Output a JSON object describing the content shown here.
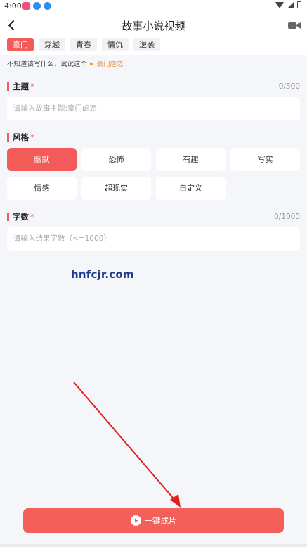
{
  "status_bar": {
    "time": "4:00"
  },
  "header": {
    "title": "故事小说视频"
  },
  "tabs": [
    {
      "label": "豪门",
      "active": true
    },
    {
      "label": "穿越",
      "active": false
    },
    {
      "label": "青春",
      "active": false
    },
    {
      "label": "情仇",
      "active": false
    },
    {
      "label": "逆袭",
      "active": false
    }
  ],
  "hint": {
    "text": "不知道该写什么，试试这个",
    "link": "豪门虐恋"
  },
  "topic": {
    "label": "主题",
    "required_mark": "*",
    "counter": "0/500",
    "placeholder": "请输入故事主题:豪门虐恋"
  },
  "style": {
    "label": "风格",
    "required_mark": "*",
    "options": [
      {
        "label": "幽默",
        "active": true
      },
      {
        "label": "恐怖",
        "active": false
      },
      {
        "label": "有趣",
        "active": false
      },
      {
        "label": "写实",
        "active": false
      },
      {
        "label": "情感",
        "active": false
      },
      {
        "label": "超现实",
        "active": false
      },
      {
        "label": "自定义",
        "active": false
      }
    ]
  },
  "word_count": {
    "label": "字数",
    "required_mark": "*",
    "counter": "0/1000",
    "placeholder": "请输入结果字数（<=1000）"
  },
  "watermark": "hnfcjr.com",
  "generate_button": {
    "label": "一键成片"
  },
  "colors": {
    "accent": "#f25b58",
    "background": "#f5f6fa",
    "arrow": "#e02020"
  }
}
